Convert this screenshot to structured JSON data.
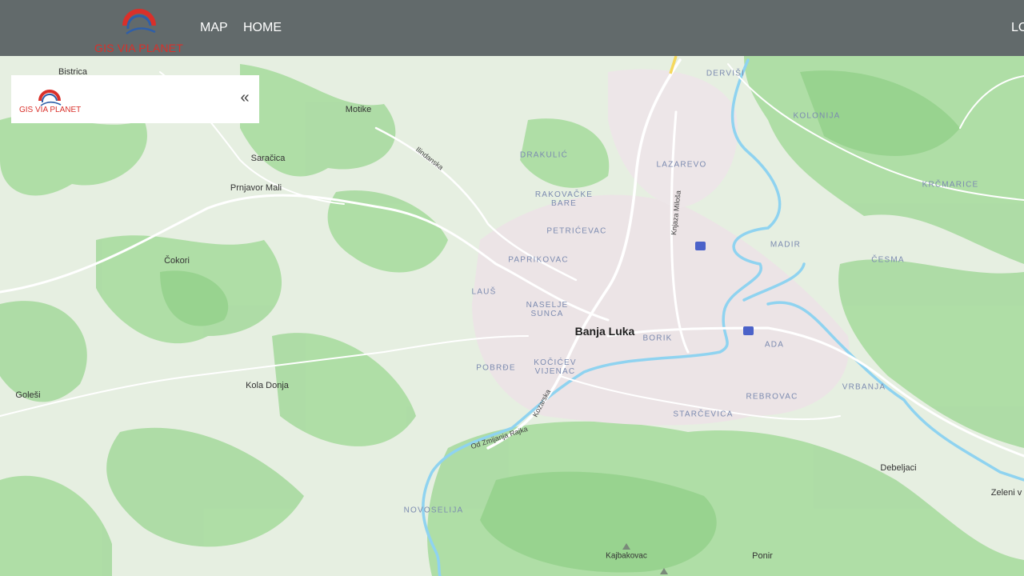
{
  "header": {
    "brand": "GIS VIA PLANET",
    "nav": [
      "MAP",
      "HOME"
    ],
    "login_label": "LO"
  },
  "panel": {
    "brand": "GIS VIA PLANET",
    "collapse_icon": "double-chevron-left-icon"
  },
  "map": {
    "places": {
      "bistrica": "Bistrica",
      "motike": "Motike",
      "saracica": "Saračica",
      "prnjavor_mali": "Prnjavor Mali",
      "cokori": "Čokori",
      "golesi": "Goleši",
      "kola_donja": "Kola Donja",
      "banja_luka": "Banja Luka",
      "debeljaci": "Debeljaci",
      "zeleni_v": "Zeleni v",
      "kajbakovac": "Kajbakovac",
      "ponir": "Ponir"
    },
    "districts": {
      "dervisi": "DERVIŠI",
      "kolonija": "KOLONIJA",
      "drakulic": "DRAKULIĆ",
      "lazarevo": "LAZAREVO",
      "krcmarice": "KRČMARICE",
      "rakovacke_bare": "RAKOVAČKE BARE",
      "petricevac": "PETRIĆEVAC",
      "madir": "MADIR",
      "paprikovac": "PAPRIKOVAC",
      "cesma": "ČESMA",
      "laus": "LAUŠ",
      "naselje_sunca": "NASELJE SUNCA",
      "borik": "BORIK",
      "ada": "ADA",
      "pobrde": "POBRĐE",
      "kocicev_vijenac": "KOČIĆEV VIJENAC",
      "vrbanja": "VRBANJA",
      "rebrovac": "REBROVAC",
      "starcevica": "STARČEVICA",
      "novoselija": "NOVOSELIJA"
    },
    "roads": {
      "ilindanska": "Ilindanska",
      "knjaza_milosa": "Knjaza Miloša",
      "kozarska": "Kozarska",
      "od_zmijanja_rajka": "Od Zmijanja Rajka"
    }
  }
}
